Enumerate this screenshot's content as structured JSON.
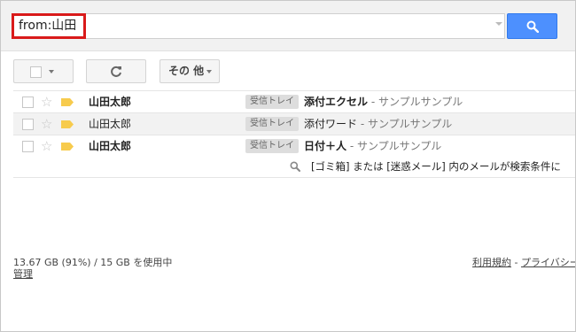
{
  "search": {
    "query": "from:山田",
    "button_icon": "search-icon"
  },
  "toolbar": {
    "more_label": "その 他"
  },
  "messages": [
    {
      "sender": "山田太郎",
      "label": "受信トレイ",
      "subject": "添付エクセル",
      "snippet": " - サンプルサンプル",
      "unread": true
    },
    {
      "sender": "山田太郎",
      "label": "受信トレイ",
      "subject": "添付ワード",
      "snippet": " - サンプルサンプル",
      "unread": false
    },
    {
      "sender": "山田太郎",
      "label": "受信トレイ",
      "subject": "日付＋人",
      "snippet": " - サンプルサンプル",
      "unread": true
    }
  ],
  "notice": {
    "text": "[ゴミ箱] または [迷惑メール] 内のメールが検索条件に"
  },
  "footer": {
    "usage": "13.67 GB (91%) / 15 GB を使用中",
    "manage": "管理",
    "terms": "利用規約",
    "separator": " - ",
    "privacy": "プライバシー"
  },
  "colors": {
    "accent_blue": "#4d90fe",
    "highlight_red": "#d91a1a",
    "tag_yellow": "#f7cb4d"
  }
}
